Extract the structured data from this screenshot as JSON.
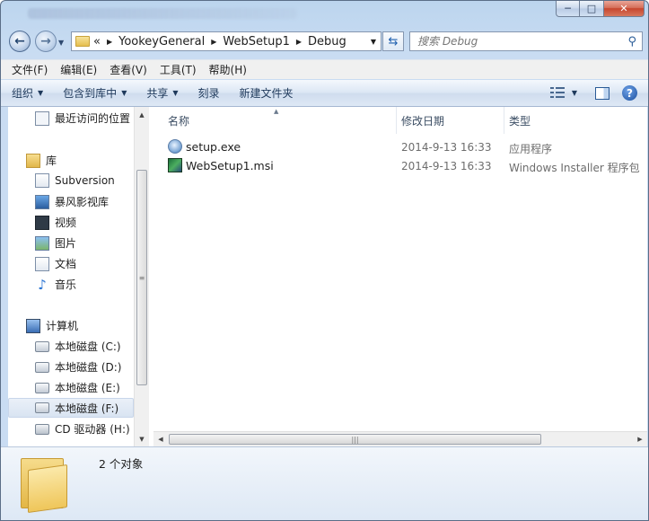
{
  "address": {
    "overflow_marker": "«",
    "crumbs": [
      "YookeyGeneral",
      "WebSetup1",
      "Debug"
    ]
  },
  "search": {
    "placeholder": "搜索 Debug"
  },
  "menu": [
    "文件(F)",
    "编辑(E)",
    "查看(V)",
    "工具(T)",
    "帮助(H)"
  ],
  "commands": {
    "organize": "组织",
    "include_in_library": "包含到库中",
    "share": "共享",
    "burn": "刻录",
    "new_folder": "新建文件夹"
  },
  "nav": {
    "recent": "最近访问的位置",
    "libraries": "库",
    "subversion": "Subversion",
    "storm": "暴风影视库",
    "videos": "视频",
    "pictures": "图片",
    "documents": "文档",
    "music": "音乐",
    "computer": "计算机",
    "drive_c": "本地磁盘 (C:)",
    "drive_d": "本地磁盘 (D:)",
    "drive_e": "本地磁盘 (E:)",
    "drive_f": "本地磁盘 (F:)",
    "drive_h": "CD 驱动器 (H:)"
  },
  "columns": {
    "name": "名称",
    "modified": "修改日期",
    "type": "类型"
  },
  "files": [
    {
      "name": "setup.exe",
      "modified": "2014-9-13 16:33",
      "type": "应用程序",
      "icon": "exe-icon"
    },
    {
      "name": "WebSetup1.msi",
      "modified": "2014-9-13 16:33",
      "type": "Windows Installer 程序包",
      "icon": "msi-icon"
    }
  ],
  "details": {
    "count": "2 个对象"
  }
}
